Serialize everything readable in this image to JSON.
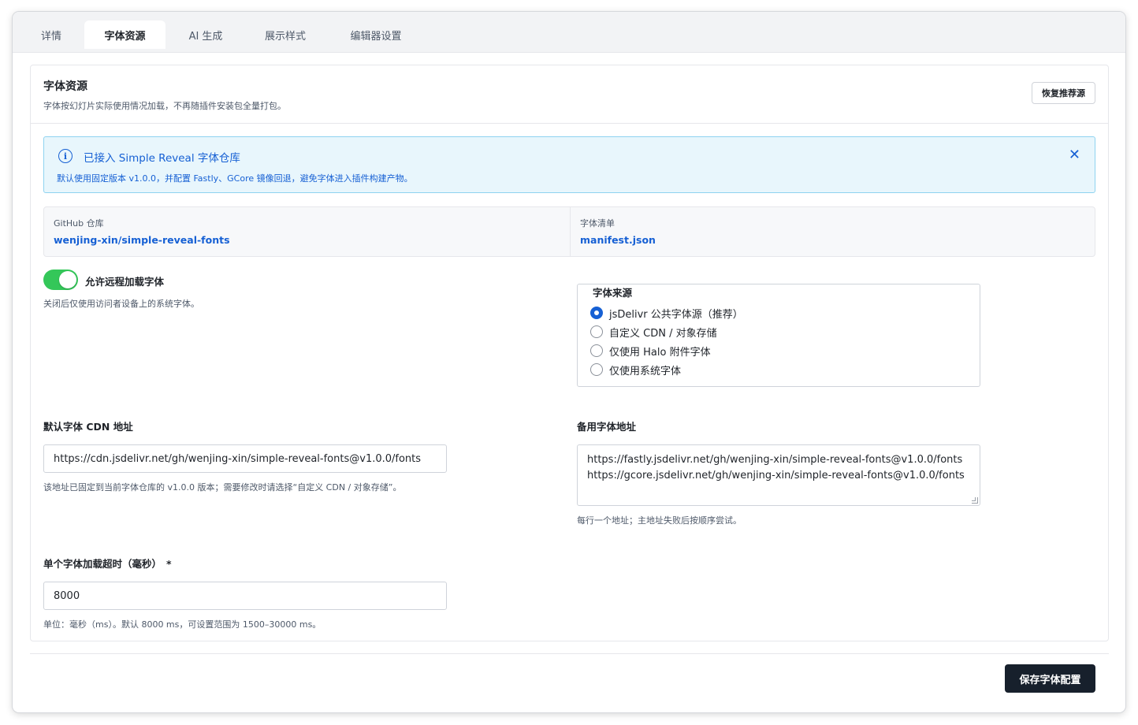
{
  "tabs": [
    {
      "label": "详情"
    },
    {
      "label": "字体资源",
      "active": true
    },
    {
      "label": "AI 生成"
    },
    {
      "label": "展示样式"
    },
    {
      "label": "编辑器设置"
    }
  ],
  "section": {
    "title": "字体资源",
    "subtitle": "字体按幻灯片实际使用情况加载，不再随插件安装包全量打包。",
    "restore_label": "恢复推荐源"
  },
  "alert": {
    "title": "已接入 Simple Reveal 字体仓库",
    "description": "默认使用固定版本 v1.0.0，并配置 Fastly、GCore 镜像回退，避免字体进入插件构建产物。",
    "icon": "info-icon",
    "close_icon": "close-icon"
  },
  "repo": {
    "github_label": "GitHub 仓库",
    "github_value": "wenjing-xin/simple-reveal-fonts",
    "manifest_label": "字体清单",
    "manifest_value": "manifest.json"
  },
  "remote_toggle": {
    "label": "允许远程加载字体",
    "hint": "关闭后仅使用访问者设备上的系统字体。",
    "enabled": true
  },
  "font_source": {
    "legend": "字体来源",
    "options": [
      {
        "label": "jsDelivr 公共字体源（推荐）",
        "checked": true
      },
      {
        "label": "自定义 CDN / 对象存储",
        "checked": false
      },
      {
        "label": "仅使用 Halo 附件字体",
        "checked": false
      },
      {
        "label": "仅使用系统字体",
        "checked": false
      }
    ]
  },
  "default_cdn": {
    "label": "默认字体 CDN 地址",
    "value": "https://cdn.jsdelivr.net/gh/wenjing-xin/simple-reveal-fonts@v1.0.0/fonts",
    "hint": "该地址已固定到当前字体仓库的 v1.0.0 版本；需要修改时请选择“自定义 CDN / 对象存储”。"
  },
  "backup_urls": {
    "label": "备用字体地址",
    "lines": [
      "https://fastly.jsdelivr.net/gh/wenjing-xin/simple-reveal-fonts@v1.0.0/fonts",
      "https://gcore.jsdelivr.net/gh/wenjing-xin/simple-reveal-fonts@v1.0.0/fonts"
    ],
    "hint": "每行一个地址；主地址失败后按顺序尝试。"
  },
  "timeout": {
    "label": "单个字体加载超时（毫秒）",
    "required_mark": "*",
    "value": "8000",
    "hint": "单位：毫秒（ms）。默认 8000 ms，可设置范围为 1500–30000 ms。"
  },
  "save_label": "保存字体配置",
  "colors": {
    "accent": "#1660d4",
    "toggle_on": "#34c759",
    "alert_bg": "#e8f6fc",
    "save_button": "#17202c"
  }
}
